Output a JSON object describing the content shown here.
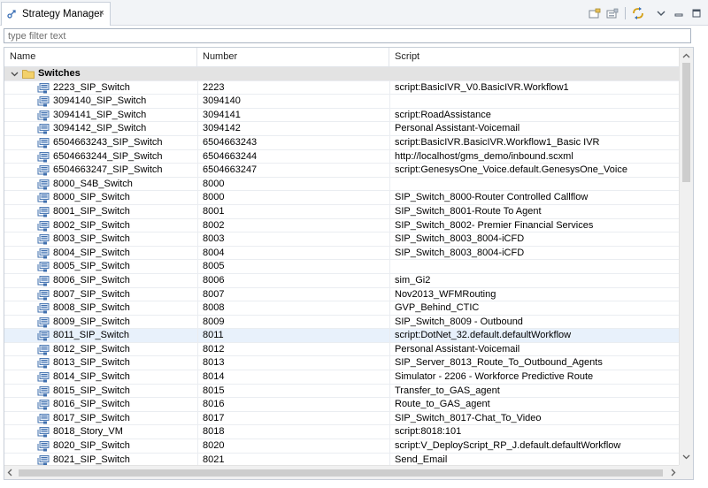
{
  "view": {
    "title": "Strategy Manager",
    "close_glyph": "×"
  },
  "toolbar": {
    "icons": [
      "new-folder-icon",
      "import-icon",
      "link-with-editor-icon",
      "view-menu-icon",
      "minimize-icon",
      "maximize-icon"
    ]
  },
  "filter": {
    "placeholder": "type filter text",
    "value": ""
  },
  "columns": {
    "name": "Name",
    "number": "Number",
    "script": "Script"
  },
  "folder": {
    "label": "Switches",
    "expanded": true
  },
  "rows": [
    {
      "name": "2223_SIP_Switch",
      "number": "2223",
      "script": "script:BasicIVR_V0.BasicIVR.Workflow1"
    },
    {
      "name": "3094140_SIP_Switch",
      "number": "3094140",
      "script": ""
    },
    {
      "name": "3094141_SIP_Switch",
      "number": "3094141",
      "script": "script:RoadAssistance"
    },
    {
      "name": "3094142_SIP_Switch",
      "number": "3094142",
      "script": "Personal Assistant-Voicemail"
    },
    {
      "name": "6504663243_SIP_Switch",
      "number": "6504663243",
      "script": "script:BasicIVR.BasicIVR.Workflow1_Basic IVR"
    },
    {
      "name": "6504663244_SIP_Switch",
      "number": "6504663244",
      "script": "http://localhost/gms_demo/inbound.scxml"
    },
    {
      "name": "6504663247_SIP_Switch",
      "number": "6504663247",
      "script": "script:GenesysOne_Voice.default.GenesysOne_Voice"
    },
    {
      "name": "8000_S4B_Switch",
      "number": "8000",
      "script": ""
    },
    {
      "name": "8000_SIP_Switch",
      "number": "8000",
      "script": "SIP_Switch_8000-Router Controlled Callflow"
    },
    {
      "name": "8001_SIP_Switch",
      "number": "8001",
      "script": "SIP_Switch_8001-Route To Agent"
    },
    {
      "name": "8002_SIP_Switch",
      "number": "8002",
      "script": "SIP_Switch_8002- Premier Financial Services"
    },
    {
      "name": "8003_SIP_Switch",
      "number": "8003",
      "script": "SIP_Switch_8003_8004-iCFD"
    },
    {
      "name": "8004_SIP_Switch",
      "number": "8004",
      "script": "SIP_Switch_8003_8004-iCFD"
    },
    {
      "name": "8005_SIP_Switch",
      "number": "8005",
      "script": ""
    },
    {
      "name": "8006_SIP_Switch",
      "number": "8006",
      "script": "sim_Gi2"
    },
    {
      "name": "8007_SIP_Switch",
      "number": "8007",
      "script": "Nov2013_WFMRouting"
    },
    {
      "name": "8008_SIP_Switch",
      "number": "8008",
      "script": "GVP_Behind_CTIC"
    },
    {
      "name": "8009_SIP_Switch",
      "number": "8009",
      "script": "SIP_Switch_8009 - Outbound"
    },
    {
      "name": "8011_SIP_Switch",
      "number": "8011",
      "script": "script:DotNet_32.default.defaultWorkflow",
      "highlighted": true
    },
    {
      "name": "8012_SIP_Switch",
      "number": "8012",
      "script": "Personal Assistant-Voicemail"
    },
    {
      "name": "8013_SIP_Switch",
      "number": "8013",
      "script": "SIP_Server_8013_Route_To_Outbound_Agents"
    },
    {
      "name": "8014_SIP_Switch",
      "number": "8014",
      "script": "Simulator - 2206 - Workforce Predictive Route"
    },
    {
      "name": "8015_SIP_Switch",
      "number": "8015",
      "script": "Transfer_to_GAS_agent"
    },
    {
      "name": "8016_SIP_Switch",
      "number": "8016",
      "script": "Route_to_GAS_agent"
    },
    {
      "name": "8017_SIP_Switch",
      "number": "8017",
      "script": "SIP_Switch_8017-Chat_To_Video"
    },
    {
      "name": "8018_Story_VM",
      "number": "8018",
      "script": "script:8018:101"
    },
    {
      "name": "8020_SIP_Switch",
      "number": "8020",
      "script": "script:V_DeployScript_RP_J.default.defaultWorkflow"
    },
    {
      "name": "8021_SIP_Switch",
      "number": "8021",
      "script": "Send_Email"
    }
  ]
}
